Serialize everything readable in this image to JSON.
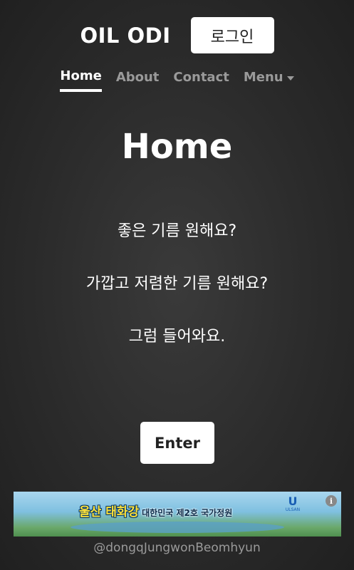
{
  "header": {
    "brand": "OIL ODI",
    "login_label": "로그인"
  },
  "nav": {
    "items": [
      {
        "label": "Home"
      },
      {
        "label": "About"
      },
      {
        "label": "Contact"
      },
      {
        "label": "Menu"
      }
    ]
  },
  "main": {
    "title": "Home",
    "lines": [
      "좋은 기름 원해요?",
      "가깝고 저렴한 기름 원해요?",
      "그럼 들어와요."
    ],
    "enter_label": "Enter"
  },
  "ad": {
    "headline": "울산 태화강",
    "subline": "대한민국 제2호 국가정원",
    "logo_letter": "U",
    "logo_text": "ULSAN",
    "info_glyph": "i"
  },
  "footer": {
    "credit": "@dongqJungwonBeomhyun"
  }
}
